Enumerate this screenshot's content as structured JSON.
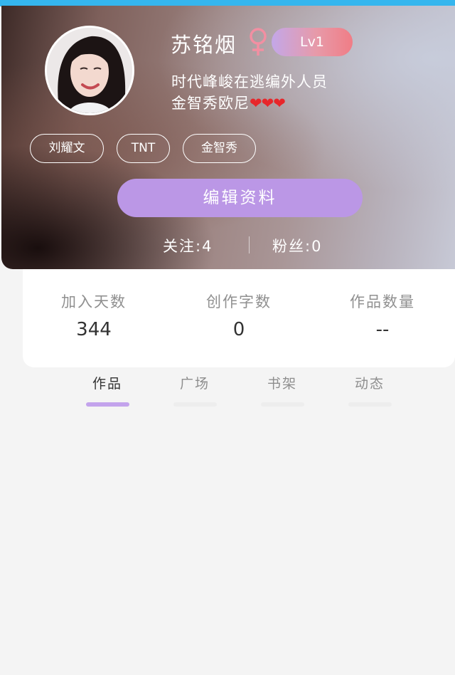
{
  "colors": {
    "top_strip": "#35b6ee",
    "accent_purple": "#bb97e6",
    "badge_gradient_start": "#c3a7e8",
    "badge_gradient_end": "#f07d86",
    "gender_icon": "#f28fa2",
    "heart": "#e8262a",
    "tab_active_underline": "#c3a3ec"
  },
  "profile": {
    "avatar_icon": "user-avatar-photo",
    "name": "苏铭烟",
    "gender_icon": "female-symbol-icon",
    "level": "Lv1",
    "bio_line1": "时代峰峻在逃编外人员",
    "bio_line2_text": "金智秀欧尼",
    "bio_line2_hearts": "❤❤❤"
  },
  "tags": [
    "刘耀文",
    "TNT",
    "金智秀"
  ],
  "edit_button": "编辑资料",
  "follow": {
    "following": "关注:4",
    "fans": "粉丝:0"
  },
  "stats": [
    {
      "label": "加入天数",
      "value": "344"
    },
    {
      "label": "创作字数",
      "value": "0"
    },
    {
      "label": "作品数量",
      "value": "--"
    }
  ],
  "tabs": [
    {
      "label": "作品",
      "active": true
    },
    {
      "label": "广场",
      "active": false
    },
    {
      "label": "书架",
      "active": false
    },
    {
      "label": "动态",
      "active": false
    }
  ]
}
